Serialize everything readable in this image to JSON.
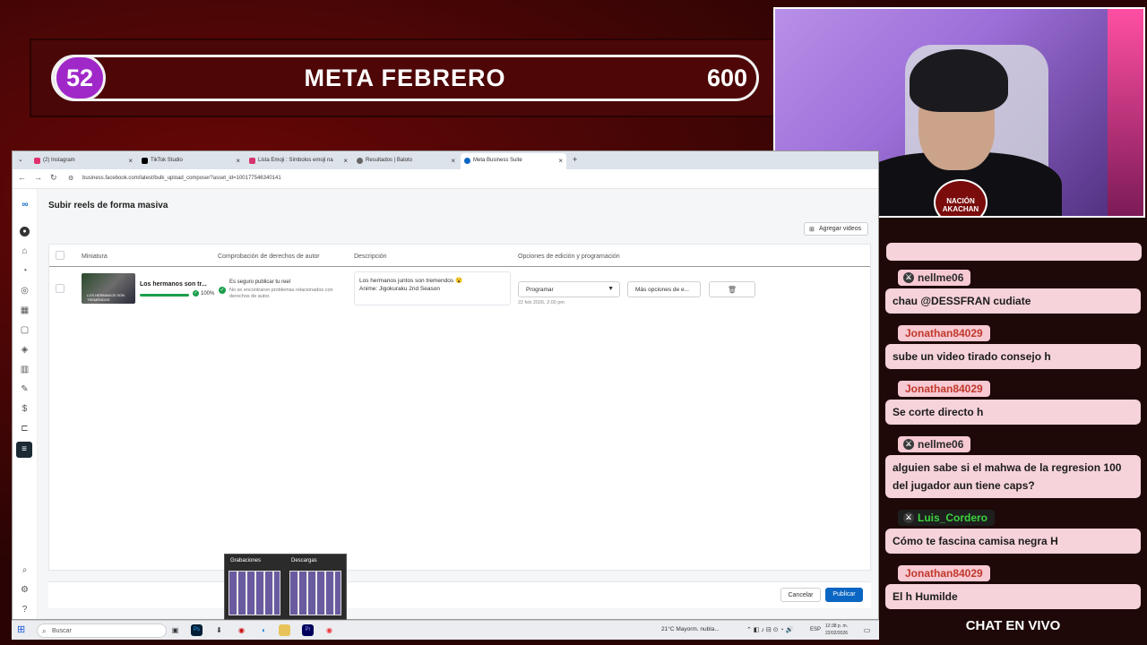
{
  "banner": {
    "left_value": "52",
    "title": "META FEBRERO",
    "right_value": "600"
  },
  "webcam": {
    "badge_text": "NACIÓN AKACHAN"
  },
  "browser": {
    "tabs": [
      {
        "label": "(2) Instagram",
        "color": "#e1306c"
      },
      {
        "label": "TikTok Studio",
        "color": "#000000"
      },
      {
        "label": "Lista Emoji : Símbolos emoji na",
        "color": "#d6336c"
      },
      {
        "label": "Resultados | Baloto",
        "color": "#666666"
      },
      {
        "label": "Meta Business Suite",
        "color": "#0a66c2"
      }
    ],
    "url": "business.facebook.com/latest/bulk_upload_composer?asset_id=100177546340141"
  },
  "page": {
    "title": "Subir reels de forma masiva",
    "add_videos": "Agregar videos",
    "columns": {
      "thumbnail": "Miniatura",
      "copyright": "Comprobación de derechos de autor",
      "description": "Descripción",
      "options": "Opciones de edición y programación"
    },
    "row": {
      "title": "Los hermanos son tr...",
      "progress_pct": "100%",
      "progress_value": 1.0,
      "thumb_text": "LOS HERMANOS SON TREMENDOS",
      "copyright_title": "Es seguro publicar tu reel",
      "copyright_detail": "No se encontraron problemas relacionados con derechos de autor.",
      "description_line1": "Los hermanos juntos son tremendos 😮",
      "description_line2": "Anime: Jigokuraku 2nd Season",
      "schedule_select": "Programar",
      "schedule_date": "22 feb 2026, 2:00 pm",
      "more_options": "Más opciones de e..."
    },
    "cancel": "Cancelar",
    "publish": "Publicar",
    "accent": "#0a66c2"
  },
  "popup": {
    "left": "Grabaciones",
    "right": "Descargas"
  },
  "taskbar": {
    "search": "Buscar",
    "weather": "21°C  Mayorm. nubla...",
    "lang": "ESP",
    "time": "12:38 p. m.",
    "date": "22/02/2026"
  },
  "chat": {
    "title": "CHAT EN VIVO",
    "messages": [
      {
        "user": "nellme06",
        "text": "chau @DESSFRAN cudiate",
        "user_color": "#2a2a2a",
        "mod": true
      },
      {
        "user": "Jonathan84029",
        "text": "sube un video tirado consejo h",
        "user_color": "#c0392b",
        "mod": false
      },
      {
        "user": "Jonathan84029",
        "text": "Se corte directo h",
        "user_color": "#c0392b",
        "mod": false
      },
      {
        "user": "nellme06",
        "text": "alguien sabe si el mahwa de la regresion 100 del jugador aun tiene caps?",
        "user_color": "#2a2a2a",
        "mod": true
      },
      {
        "user": "Luis_Cordero",
        "text": "Cómo te fascina camisa negra H",
        "user_color": "#3cd23c",
        "mod": true
      },
      {
        "user": "Jonathan84029",
        "text": "El h Humilde",
        "user_color": "#c0392b",
        "mod": false
      }
    ]
  }
}
